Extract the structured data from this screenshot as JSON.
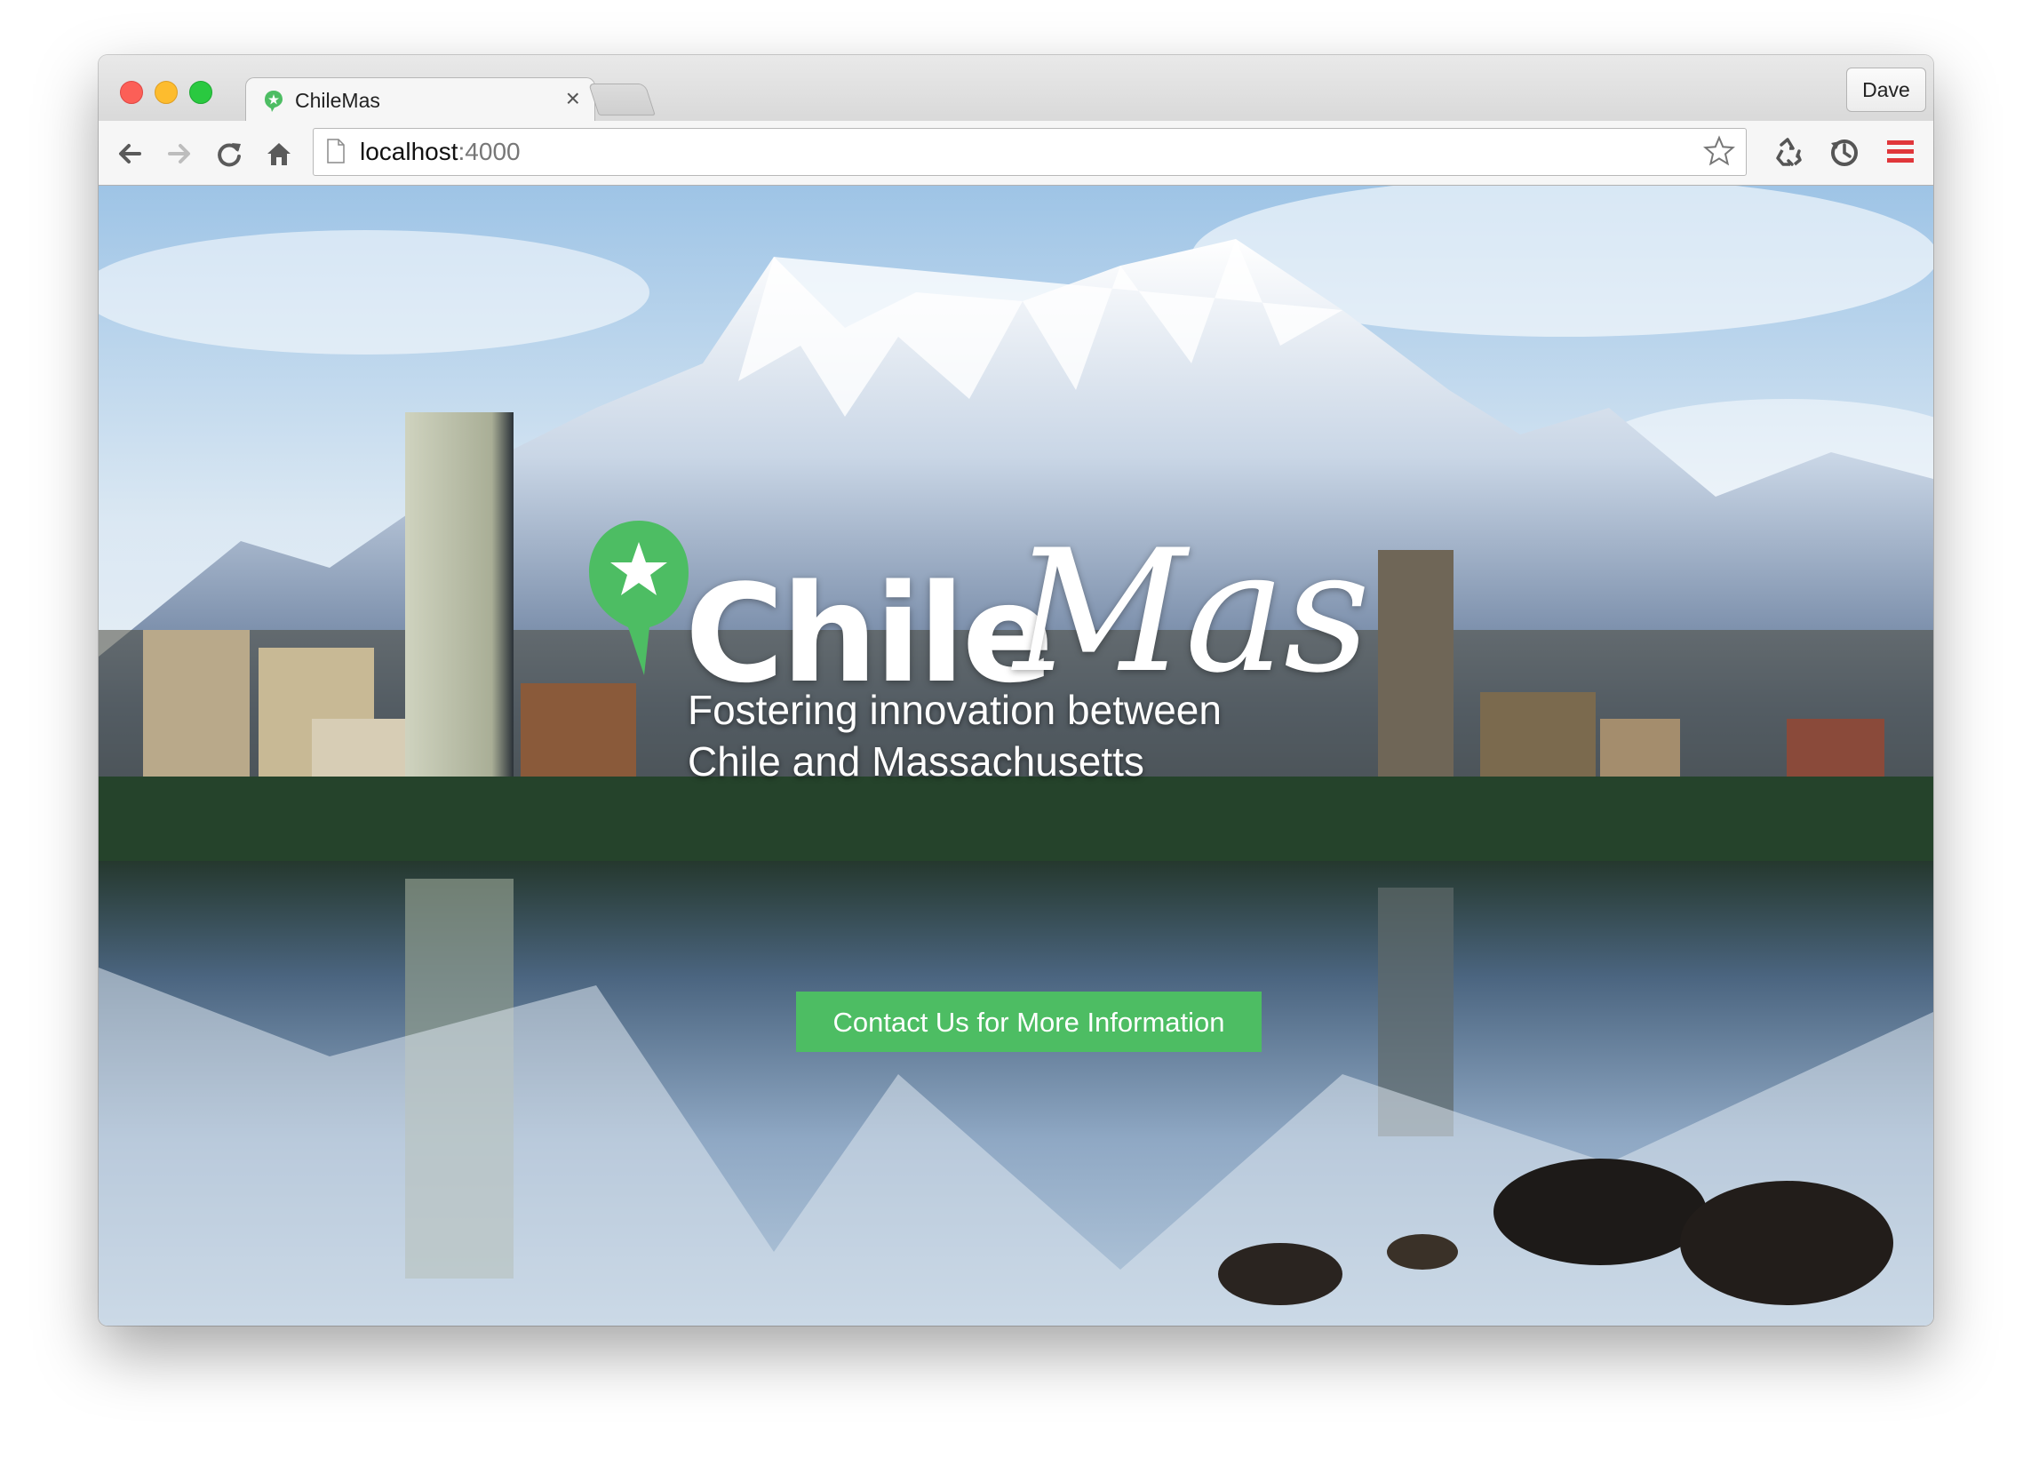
{
  "browser": {
    "tab_title": "ChileMas",
    "tab_close": "×",
    "profile_label": "Dave",
    "url_host": "localhost",
    "url_port": ":4000"
  },
  "hero": {
    "logo_part1": "Chile",
    "logo_part2": "Mas",
    "tagline_line1": "Fostering innovation between",
    "tagline_line2": "Chile and Massachusetts",
    "cta_label": "Contact Us for More Information"
  },
  "colors": {
    "brand_green": "#4dbd63",
    "menu_red": "#e0373b"
  },
  "icons": [
    "back-icon",
    "forward-icon",
    "reload-icon",
    "home-icon",
    "page-icon",
    "bookmark-star-icon",
    "recycle-extension-icon",
    "sync-extension-icon",
    "menu-icon"
  ]
}
